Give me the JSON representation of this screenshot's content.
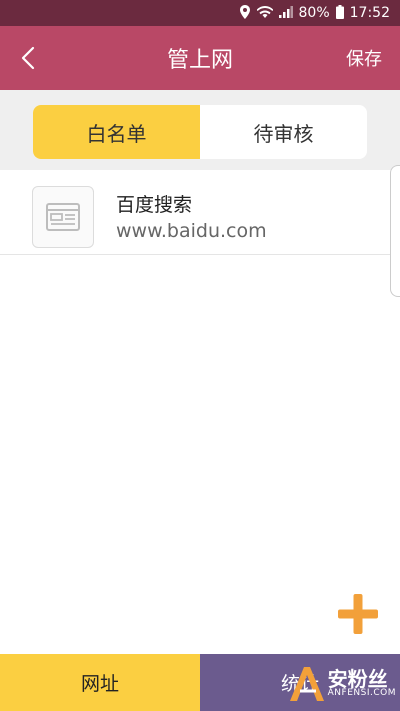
{
  "status_bar": {
    "battery": "80%",
    "time": "17:52"
  },
  "app_bar": {
    "title": "管上网",
    "save_label": "保存"
  },
  "segment": {
    "tabs": [
      {
        "label": "白名单",
        "active": true
      },
      {
        "label": "待审核",
        "active": false
      }
    ]
  },
  "list": {
    "items": [
      {
        "name": "百度搜索",
        "url": "www.baidu.com"
      }
    ]
  },
  "bottom_nav": {
    "tabs": [
      {
        "label": "网址"
      },
      {
        "label": "统计"
      }
    ]
  },
  "watermark": {
    "main": "安粉丝",
    "sub": "ANFENSI.COM"
  },
  "colors": {
    "status_bar": "#6b2a3f",
    "app_bar": "#b94866",
    "accent_yellow": "#fbcf41",
    "fab_orange": "#f2a03a",
    "stats_tab": "#6b5b8e"
  }
}
